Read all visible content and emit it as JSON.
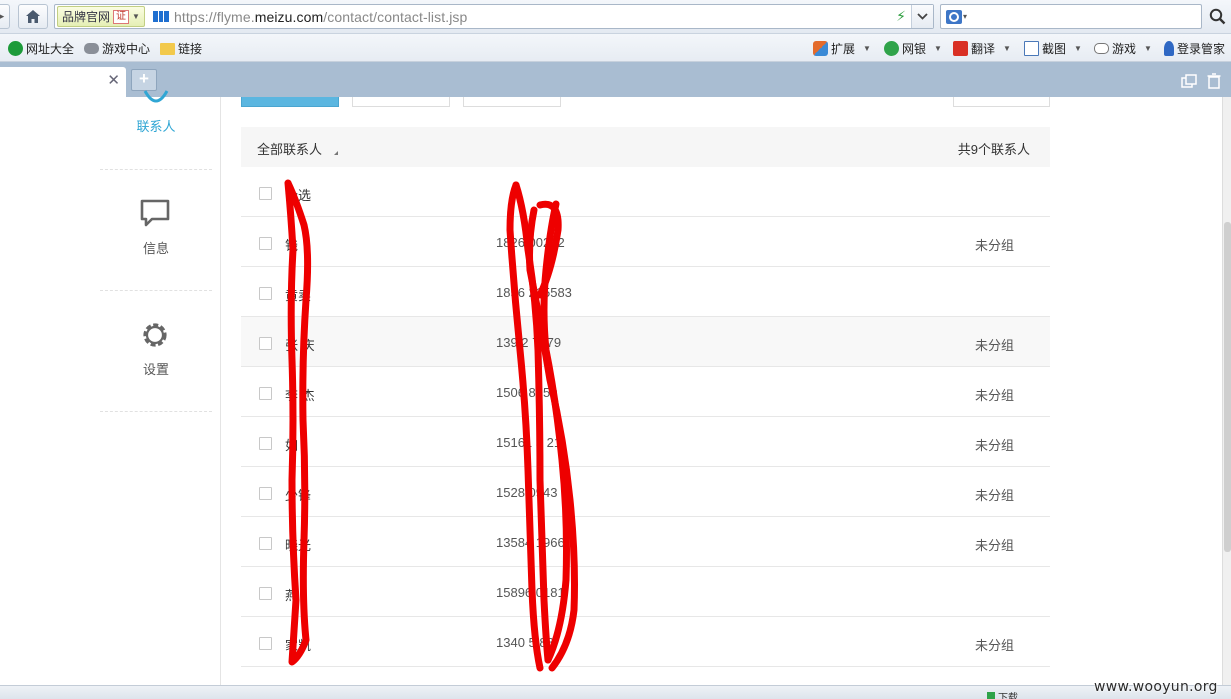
{
  "browser": {
    "brand_badge": "品牌官网",
    "cert_label": "证",
    "url_prefix": "https://flyme.",
    "url_domain": "meizu.com",
    "url_path": "/contact/contact-list.jsp",
    "favorites": [
      {
        "label": "网址大全",
        "icon": "globe-plus-icon"
      },
      {
        "label": "游戏中心",
        "icon": "gamepad-icon"
      },
      {
        "label": "链接",
        "icon": "folder-icon"
      }
    ],
    "tools": [
      {
        "label": "扩展",
        "icon": "cube-icon"
      },
      {
        "label": "网银",
        "icon": "bank-shield-icon"
      },
      {
        "label": "翻译",
        "icon": "translate-icon"
      },
      {
        "label": "截图",
        "icon": "screenshot-icon"
      },
      {
        "label": "游戏",
        "icon": "gamepad-icon"
      },
      {
        "label": "登录管家",
        "icon": "key-icon"
      }
    ],
    "new_tab_label": "+"
  },
  "sidebar": {
    "items": [
      {
        "label": "联系人",
        "icon": "contacts-icon",
        "active": true
      },
      {
        "label": "信息",
        "icon": "message-icon",
        "active": false
      },
      {
        "label": "设置",
        "icon": "gear-icon",
        "active": false
      }
    ]
  },
  "contacts": {
    "header_title": "全部联系人",
    "header_count": "共9个联系人",
    "select_all_label": "全选",
    "rows": [
      {
        "name": "钱",
        "phone": "1826 00212",
        "group": "未分组"
      },
      {
        "name": "黄卖",
        "phone": "1856 215583",
        "group": ""
      },
      {
        "name": "张 庆",
        "phone": "139 2 7179",
        "group": "未分组"
      },
      {
        "name": "李 杰",
        "phone": "1506 8550",
        "group": "未分组"
      },
      {
        "name": "如",
        "phone": "15161 5 21",
        "group": "未分组"
      },
      {
        "name": "少锋",
        "phone": "1528 0943",
        "group": "未分组"
      },
      {
        "name": "晓光",
        "phone": "13584 1966",
        "group": "未分组"
      },
      {
        "name": "燕",
        "phone": "15896 0181",
        "group": ""
      },
      {
        "name": "家凯",
        "phone": "1340 5 88",
        "group": "未分组"
      }
    ]
  },
  "status": {
    "download_label": "下载"
  },
  "watermark": "www.wooyun.org",
  "colors": {
    "accent": "#30a6d4",
    "scribble": "#ee0000",
    "tabstrip": "#a9bdd2"
  }
}
